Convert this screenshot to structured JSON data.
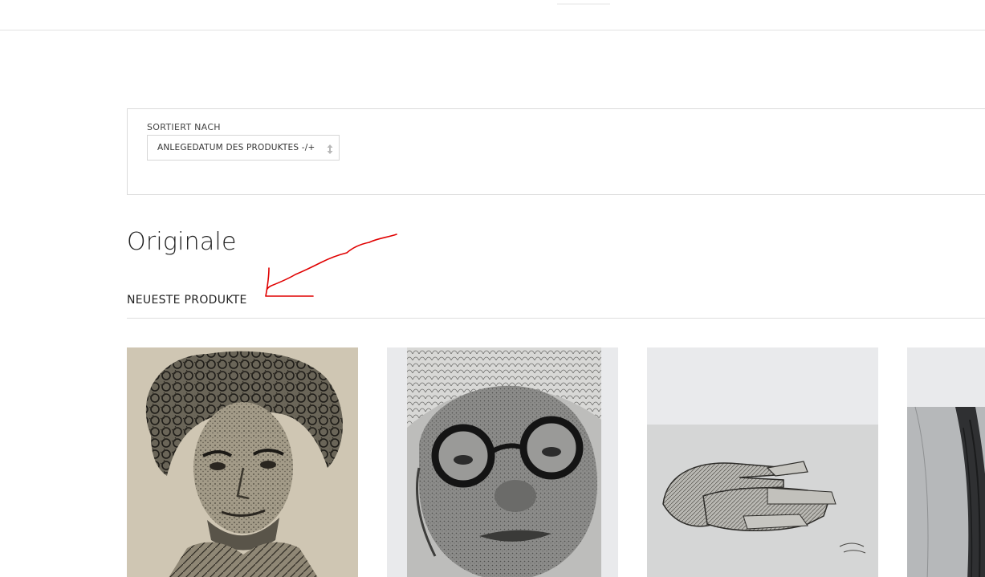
{
  "sort": {
    "label": "SORTIERT NACH",
    "selected": "ANLEGEDATUM DES PRODUKTES -/+"
  },
  "page": {
    "title": "Originale"
  },
  "section": {
    "heading": "NEUESTE PRODUKTE"
  },
  "products": [
    {
      "image": "curly-hair-man-portrait-drawing"
    },
    {
      "image": "man-with-glasses-portrait-drawing"
    },
    {
      "image": "hands-drawing"
    },
    {
      "image": "portrait-drawing-partial"
    }
  ],
  "colors": {
    "annotation": "#e00000",
    "card_background": "#e9eaec",
    "border": "#dcdcdc"
  }
}
